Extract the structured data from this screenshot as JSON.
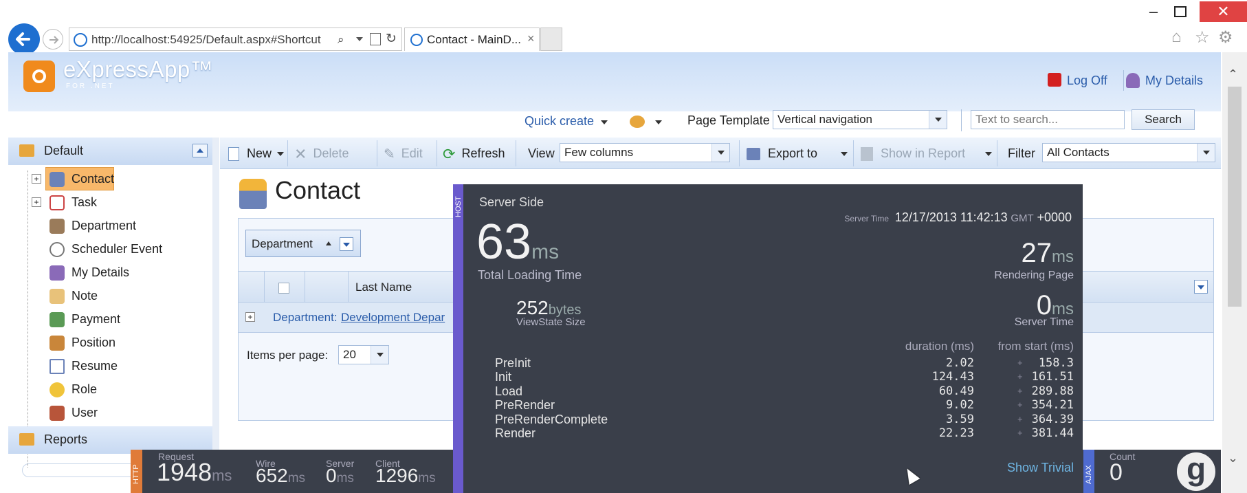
{
  "browser": {
    "url": "http://localhost:54925/Default.aspx#Shortcut",
    "tab_title": "Contact - MainD...",
    "tab_close": "×"
  },
  "app": {
    "logo": "eXpressApp™",
    "logo_sub": "FOR .NET",
    "logoff": "Log Off",
    "my_details": "My Details",
    "quick_create": "Quick create",
    "page_template_label": "Page Template",
    "page_template_value": "Vertical navigation",
    "search_placeholder": "Text to search...",
    "search_button": "Search"
  },
  "nav": {
    "group_default": "Default",
    "items": [
      {
        "label": "Contact"
      },
      {
        "label": "Task"
      },
      {
        "label": "Department"
      },
      {
        "label": "Scheduler Event"
      },
      {
        "label": "My Details"
      },
      {
        "label": "Note"
      },
      {
        "label": "Payment"
      },
      {
        "label": "Position"
      },
      {
        "label": "Resume"
      },
      {
        "label": "Role"
      },
      {
        "label": "User"
      }
    ],
    "group_reports": "Reports"
  },
  "toolbar": {
    "new": "New",
    "delete": "Delete",
    "edit": "Edit",
    "refresh": "Refresh",
    "view_label": "View",
    "view_value": "Few columns",
    "export": "Export to",
    "show_in_report": "Show in Report",
    "filter_label": "Filter",
    "filter_value": "All Contacts"
  },
  "content": {
    "title": "Contact",
    "group_panel": "Department",
    "col_last_name": "Last Name",
    "group_row_label": "Department:",
    "group_row_value": "Development Depar",
    "items_per_page_label": "Items per page:",
    "items_per_page_value": "20"
  },
  "perf": {
    "host_tab": "HOST",
    "heading": "Server Side",
    "server_time_label": "Server Time",
    "server_time_value": "12/17/2013 11:42:13",
    "gmt": "GMT",
    "tz": "+0000",
    "total_value": "63",
    "total_unit": "ms",
    "total_label": "Total Loading Time",
    "render_value": "27",
    "render_unit": "ms",
    "render_label": "Rendering Page",
    "viewstate_value": "252",
    "viewstate_unit": "bytes",
    "viewstate_label": "ViewState Size",
    "servertime_value": "0",
    "servertime_unit": "ms",
    "servertime_label": "Server Time",
    "col_duration": "duration (ms)",
    "col_from_start": "from start (ms)",
    "rows": [
      {
        "name": "PreInit",
        "duration": "2.02",
        "from_start": "158.3"
      },
      {
        "name": "Init",
        "duration": "124.43",
        "from_start": "161.51"
      },
      {
        "name": "Load",
        "duration": "60.49",
        "from_start": "289.88"
      },
      {
        "name": "PreRender",
        "duration": "9.02",
        "from_start": "354.21"
      },
      {
        "name": "PreRenderComplete",
        "duration": "3.59",
        "from_start": "364.39"
      },
      {
        "name": "Render",
        "duration": "22.23",
        "from_start": "381.44"
      }
    ],
    "plus": "+",
    "show_trivial": "Show Trivial"
  },
  "http_bar": {
    "http_tab": "HTTP",
    "request_label": "Request",
    "request_value": "1948",
    "request_unit": "ms",
    "wire_label": "Wire",
    "wire_value": "652",
    "wire_unit": "ms",
    "server_label": "Server",
    "server_value": "0",
    "server_unit": "ms",
    "client_label": "Client",
    "client_value": "1296",
    "client_unit": "ms",
    "ajax_tab": "AJAX",
    "count_label": "Count",
    "count_value": "0",
    "glimpse_logo": "g"
  },
  "colors": {
    "accent": "#1e6fd0",
    "overlay_bg": "#3a3f4a",
    "host_tab": "#6a5acd",
    "http_tab": "#e07b39",
    "link": "#2a5caa"
  }
}
